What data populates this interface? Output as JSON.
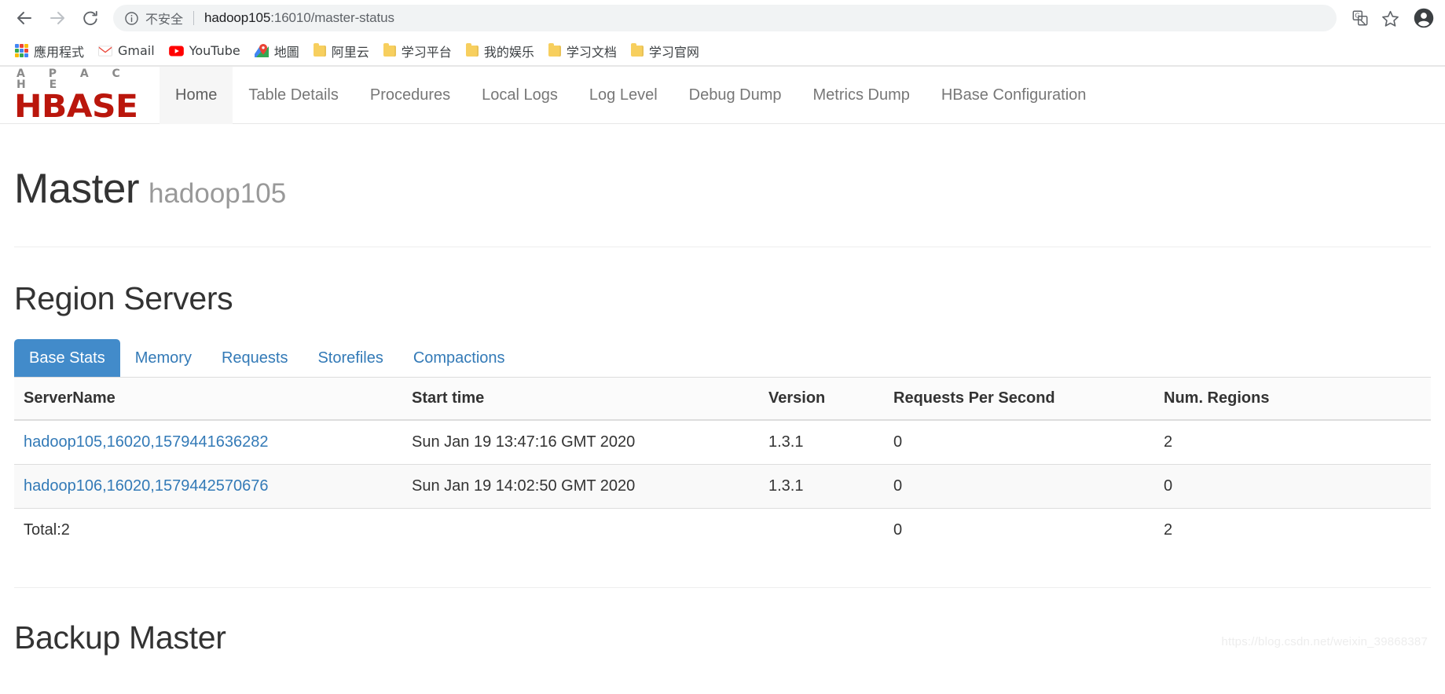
{
  "browser": {
    "back_label": "Back",
    "forward_label": "Forward",
    "reload_label": "Reload",
    "security_text": "不安全",
    "url_host": "hadoop105",
    "url_rest": ":16010/master-status",
    "translate_label": "Translate this page",
    "bookmark_star_label": "Bookmark this tab",
    "profile_label": "Profile",
    "bookmarks": [
      {
        "label": "應用程式",
        "icon": "apps-grid-icon"
      },
      {
        "label": "Gmail",
        "icon": "gmail-icon"
      },
      {
        "label": "YouTube",
        "icon": "youtube-icon"
      },
      {
        "label": "地圖",
        "icon": "maps-icon"
      },
      {
        "label": "阿里云",
        "icon": "folder-icon"
      },
      {
        "label": "学习平台",
        "icon": "folder-icon"
      },
      {
        "label": "我的娱乐",
        "icon": "folder-icon"
      },
      {
        "label": "学习文档",
        "icon": "folder-icon"
      },
      {
        "label": "学习官网",
        "icon": "folder-icon"
      }
    ]
  },
  "site": {
    "brand_top": "A P A C H E",
    "brand_main": "HBASE",
    "brand_color": "#ba160c",
    "nav": [
      {
        "label": "Home",
        "active": true
      },
      {
        "label": "Table Details",
        "active": false
      },
      {
        "label": "Procedures",
        "active": false
      },
      {
        "label": "Local Logs",
        "active": false
      },
      {
        "label": "Log Level",
        "active": false
      },
      {
        "label": "Debug Dump",
        "active": false
      },
      {
        "label": "Metrics Dump",
        "active": false
      },
      {
        "label": "HBase Configuration",
        "active": false
      }
    ]
  },
  "master": {
    "title": "Master",
    "hostname": "hadoop105"
  },
  "region_servers": {
    "section_title": "Region Servers",
    "accent_color": "#428bca",
    "link_color": "#337ab7",
    "tabs": [
      {
        "label": "Base Stats",
        "active": true
      },
      {
        "label": "Memory",
        "active": false
      },
      {
        "label": "Requests",
        "active": false
      },
      {
        "label": "Storefiles",
        "active": false
      },
      {
        "label": "Compactions",
        "active": false
      }
    ],
    "columns": [
      "ServerName",
      "Start time",
      "Version",
      "Requests Per Second",
      "Num. Regions"
    ],
    "rows": [
      {
        "server_name": "hadoop105,16020,1579441636282",
        "start_time": "Sun Jan 19 13:47:16 GMT 2020",
        "version": "1.3.1",
        "requests_per_second": "0",
        "num_regions": "2"
      },
      {
        "server_name": "hadoop106,16020,1579442570676",
        "start_time": "Sun Jan 19 14:02:50 GMT 2020",
        "version": "1.3.1",
        "requests_per_second": "0",
        "num_regions": "0"
      }
    ],
    "total": {
      "label": "Total:2",
      "start_time": "",
      "version": "",
      "requests_per_second": "0",
      "num_regions": "2"
    }
  },
  "backup_masters": {
    "section_title": "Backup Master"
  },
  "watermark": {
    "text": "https://blog.csdn.net/weixin_39868387"
  }
}
